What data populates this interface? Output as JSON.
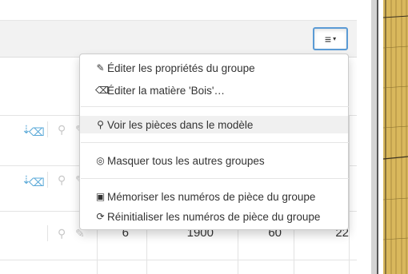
{
  "menu_button": {
    "icon": "hamburger-icon",
    "label": "≡",
    "caret": "▾"
  },
  "dropdown": {
    "items": [
      {
        "icon": "pencil-icon",
        "glyph": "✎",
        "label": "Éditer les propriétés du groupe"
      },
      {
        "icon": "eraser-icon",
        "glyph": "⌫",
        "label": "Éditer la matière 'Bois'…"
      },
      {
        "icon": "search-icon",
        "glyph": "⚲",
        "label": "Voir les pièces dans le modèle"
      },
      {
        "icon": "eye-slash-icon",
        "glyph": "◎",
        "label": "Masquer tous les autres groupes"
      },
      {
        "icon": "save-icon",
        "glyph": "▣",
        "label": "Mémoriser les numéros de pièce du groupe"
      },
      {
        "icon": "refresh-icon",
        "glyph": "⟳",
        "label": "Réinitialiser les numéros de pièce du groupe"
      }
    ]
  },
  "table": {
    "rows": [
      {
        "values": []
      },
      {
        "values": []
      },
      {
        "values": [
          "6",
          "1900",
          "60",
          "22"
        ]
      }
    ]
  },
  "colors": {
    "accent": "#5b9bd5",
    "row_icon": "#5aa9d8",
    "model": "#d9b85c"
  }
}
